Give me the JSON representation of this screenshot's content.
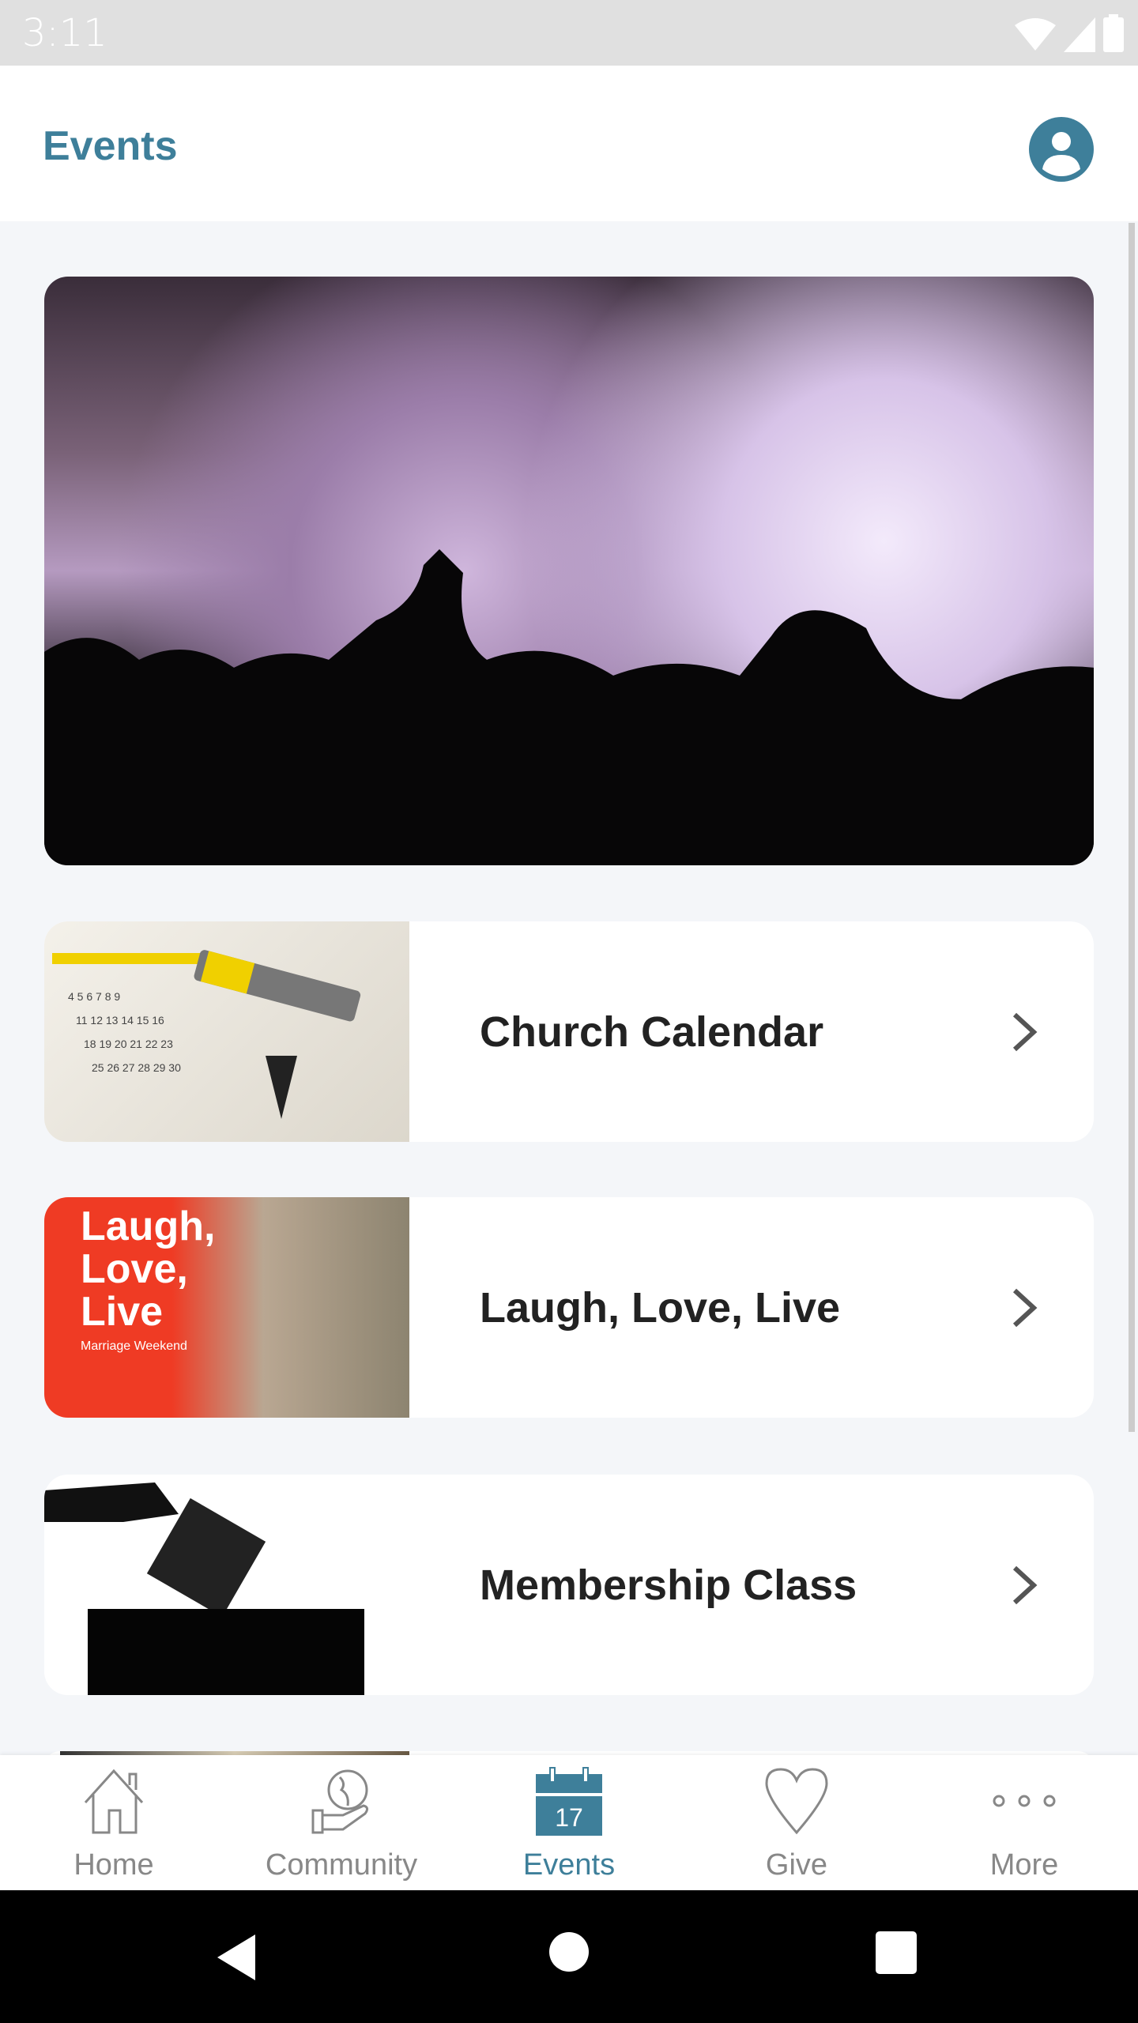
{
  "status_bar": {
    "time": "3:11",
    "icons": [
      "wifi-icon",
      "signal-icon",
      "battery-icon"
    ]
  },
  "header": {
    "title": "Events",
    "profile_icon": "account-circle-icon"
  },
  "colors": {
    "accent": "#3e7f9a",
    "background": "#f4f6f9",
    "text": "#222222",
    "inactive": "#888888"
  },
  "events": [
    {
      "label": "Church Calendar"
    },
    {
      "label": "Laugh, Love, Live",
      "thumb_text": "Laugh, Love, Live",
      "thumb_subtext": "Marriage Weekend"
    },
    {
      "label": "Membership Class"
    }
  ],
  "bottom_nav": [
    {
      "label": "Home",
      "icon": "home-icon"
    },
    {
      "label": "Community",
      "icon": "globe-hand-icon"
    },
    {
      "label": "Events",
      "icon": "calendar-icon",
      "badge": "17",
      "active": true
    },
    {
      "label": "Give",
      "icon": "heart-icon"
    },
    {
      "label": "More",
      "icon": "more-dots-icon"
    }
  ]
}
